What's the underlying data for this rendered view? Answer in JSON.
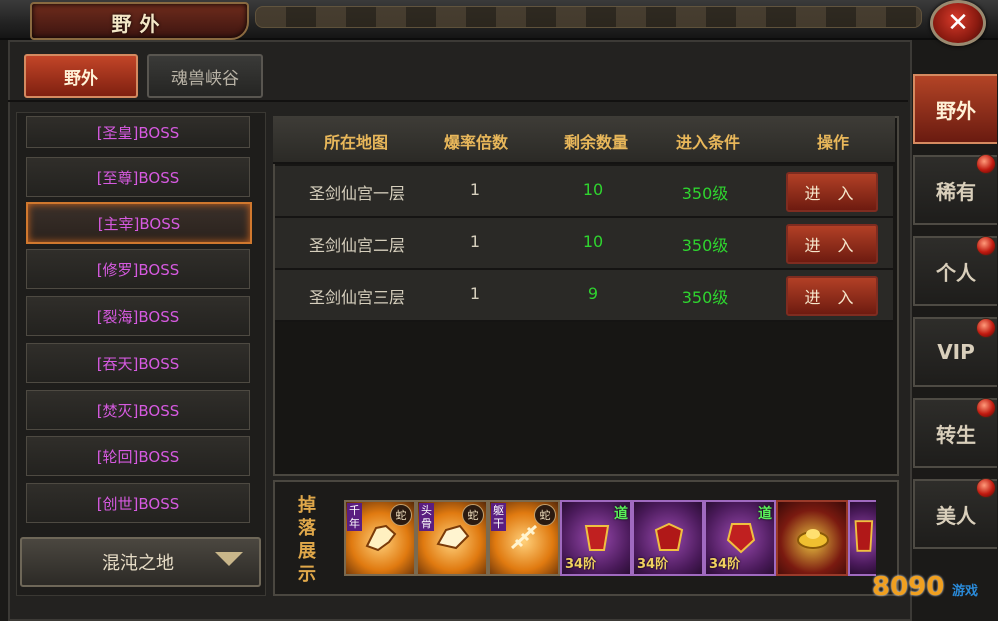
{
  "header": {
    "title": "野外",
    "close_glyph": "✕"
  },
  "top_tabs": [
    {
      "label": "野外",
      "active": true
    },
    {
      "label": "魂兽峡谷",
      "active": false
    }
  ],
  "boss_list": [
    {
      "label": "[圣皇]BOSS"
    },
    {
      "label": "[至尊]BOSS"
    },
    {
      "label": "[主宰]BOSS",
      "selected": true
    },
    {
      "label": "[修罗]BOSS"
    },
    {
      "label": "[裂海]BOSS"
    },
    {
      "label": "[吞天]BOSS"
    },
    {
      "label": "[焚灭]BOSS"
    },
    {
      "label": "[轮回]BOSS"
    },
    {
      "label": "[创世]BOSS"
    }
  ],
  "zone_select": {
    "value": "混沌之地"
  },
  "table": {
    "columns": [
      "所在地图",
      "爆率倍数",
      "剩余数量",
      "进入条件",
      "操作"
    ],
    "rows": [
      {
        "map": "圣剑仙宫一层",
        "rate": "1",
        "remaining": "10",
        "condition": "350级",
        "action": "进 入"
      },
      {
        "map": "圣剑仙宫二层",
        "rate": "1",
        "remaining": "10",
        "condition": "350级",
        "action": "进 入"
      },
      {
        "map": "圣剑仙宫三层",
        "rate": "1",
        "remaining": "9",
        "condition": "350级",
        "action": "进 入"
      }
    ]
  },
  "drops": {
    "label": "掉落展示",
    "items": [
      {
        "tag": "千年",
        "badge": "蛇",
        "style": "orange",
        "icon": "dragon-skull-icon"
      },
      {
        "tag": "头骨",
        "badge": "蛇",
        "style": "orange",
        "icon": "dragon-skull-icon"
      },
      {
        "tag": "躯干",
        "badge": "蛇",
        "style": "orange",
        "icon": "bone-icon"
      },
      {
        "dao": "道",
        "level": "34阶",
        "style": "purple",
        "icon": "armor-icon"
      },
      {
        "dao": "",
        "level": "34阶",
        "style": "purple",
        "icon": "armor-icon"
      },
      {
        "dao": "道",
        "level": "34阶",
        "style": "purple",
        "icon": "armor-icon"
      },
      {
        "style": "red",
        "icon": "gold-ingot-icon"
      },
      {
        "style": "purple",
        "icon": "armor-icon"
      }
    ]
  },
  "side_tabs": [
    {
      "label": "野外",
      "active": true
    },
    {
      "label": "稀有",
      "active": false
    },
    {
      "label": "个人",
      "active": false
    },
    {
      "label": "VIP",
      "active": false
    },
    {
      "label": "转生",
      "active": false
    },
    {
      "label": "美人",
      "active": false
    }
  ],
  "watermark": {
    "text": "8090",
    "sub": "游戏"
  }
}
